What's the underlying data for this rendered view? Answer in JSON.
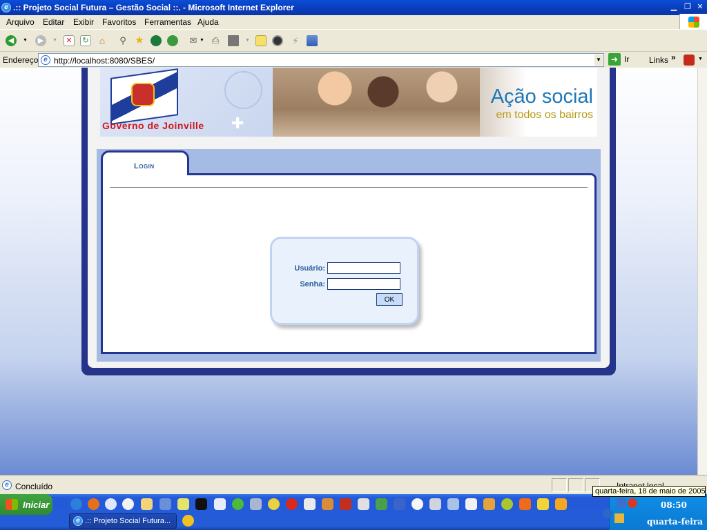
{
  "window": {
    "title": ".:: Projeto Social Futura – Gestão Social ::. - Microsoft Internet Explorer"
  },
  "menu": [
    "Arquivo",
    "Editar",
    "Exibir",
    "Favoritos",
    "Ferramentas",
    "Ajuda"
  ],
  "address": {
    "label": "Endereço",
    "url": "http://localhost:8080/SBES/",
    "go_label": "Ir",
    "links_label": "Links"
  },
  "header": {
    "gov_text": "Governo de Joinville",
    "acao": "Ação social",
    "bairros": "em todos os bairros"
  },
  "tab": {
    "label": "Login"
  },
  "login": {
    "user_label": "Usuário:",
    "pass_label": "Senha:",
    "user_value": "",
    "pass_value": "",
    "ok_label": "OK"
  },
  "status": {
    "text": "Concluído",
    "zone": "Intranet local"
  },
  "taskbar": {
    "start_label": "Iniciar",
    "task_title": ".:: Projeto Social Futura...",
    "time": "08:50",
    "day": "quarta-feira",
    "tooltip": "quarta-feira, 18 de maio de 2005"
  },
  "colors": {
    "frame": "#25338a",
    "accent": "#2c5f9c",
    "ie_blue": "#0a4fd8"
  }
}
